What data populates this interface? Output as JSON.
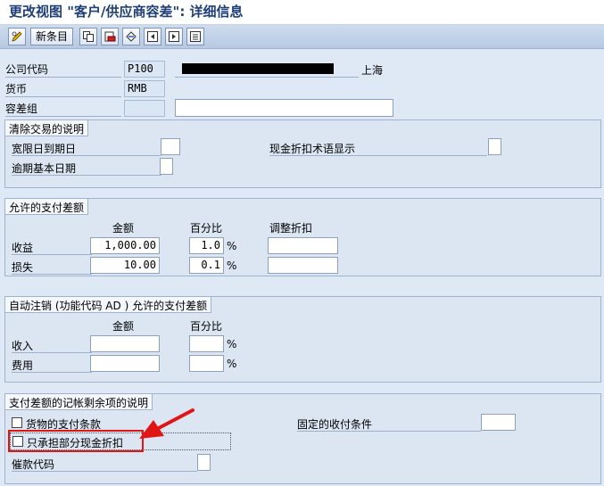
{
  "window": {
    "title": "更改视图 \"客户/供应商容差\": 详细信息"
  },
  "toolbar": {
    "new_entries_label": "新条目"
  },
  "header": {
    "company_code_label": "公司代码",
    "company_code_value": "P100",
    "city": "上海",
    "currency_label": "货币",
    "currency_value": "RMB",
    "tolerance_group_label": "容差组",
    "tolerance_group_value": "",
    "tolerance_group_desc": ""
  },
  "clearing": {
    "title": "清除交易的说明",
    "grace_days_label": "宽限日到期日",
    "grace_days_value": "",
    "cash_discount_terms_label": "现金折扣术语显示",
    "cash_discount_terms_value": "",
    "arrears_base_date_label": "逾期基本日期",
    "arrears_base_date_value": ""
  },
  "permitted": {
    "title": "允许的支付差额",
    "col_amount": "金额",
    "col_percent": "百分比",
    "col_adjust": "调整折扣",
    "rows": [
      {
        "label": "收益",
        "amount": "1,000.00",
        "percent": "1.0",
        "pct_sign": "%",
        "adjust": ""
      },
      {
        "label": "损失",
        "amount": "10.00",
        "percent": "0.1",
        "pct_sign": "%",
        "adjust": ""
      }
    ]
  },
  "auto_writeoff": {
    "title": "自动注销 (功能代码 AD ) 允许的支付差额",
    "col_amount": "金额",
    "col_percent": "百分比",
    "rows": [
      {
        "label": "收入",
        "amount": "",
        "percent": "",
        "pct_sign": "%"
      },
      {
        "label": "费用",
        "amount": "",
        "percent": "",
        "pct_sign": "%"
      }
    ]
  },
  "posting": {
    "title": "支付差额的记帐剩余项的说明",
    "payment_terms_label": "货物的支付条款",
    "fixed_terms_label": "固定的收付条件",
    "fixed_terms_value": "",
    "partial_discount_label": "只承担部分现金折扣",
    "dunning_key_label": "催款代码",
    "dunning_key_value": ""
  },
  "annotation": {
    "arrow_color": "#e01616"
  }
}
